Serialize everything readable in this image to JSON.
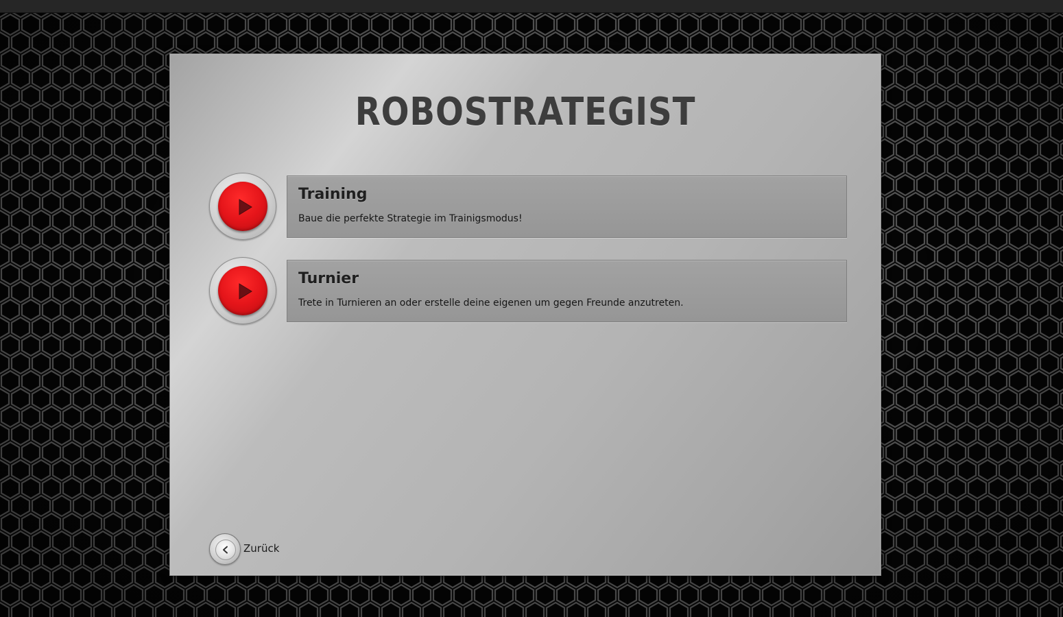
{
  "app": {
    "title": "ROBOSTRATEGIST"
  },
  "modes": [
    {
      "title": "Training",
      "description": "Baue die perfekte Strategie im Trainigsmodus!",
      "icon": "play-icon"
    },
    {
      "title": "Turnier",
      "description": "Trete in Turnieren an oder erstelle deine eigenen um gegen Freunde anzutreten.",
      "icon": "play-icon"
    }
  ],
  "navigation": {
    "back_label": "Zurück",
    "back_icon": "chevron-left-icon"
  },
  "colors": {
    "accent_red": "#e5151a",
    "title_text": "#3d3d3d",
    "panel_metal": "#bcbcbc",
    "background_hex": "#0c0c0c"
  }
}
